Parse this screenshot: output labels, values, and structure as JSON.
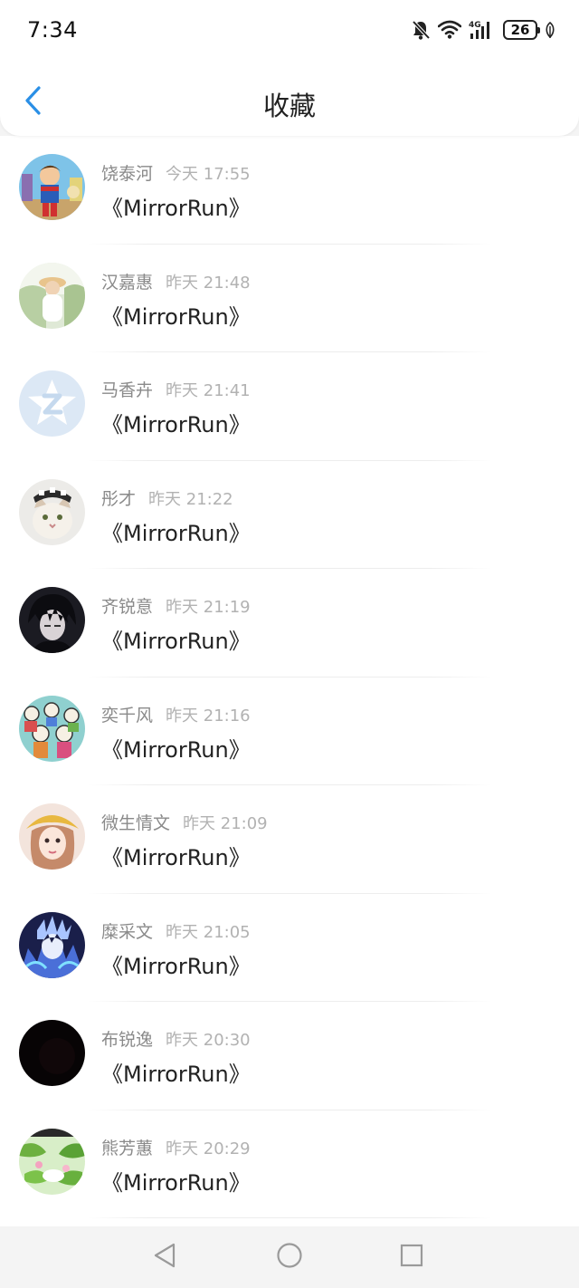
{
  "status_bar": {
    "time": "7:34",
    "network": "4G",
    "battery": "26"
  },
  "header": {
    "title": "收藏",
    "back_icon": "chevron-left-icon",
    "accent_color": "#2a8fe6"
  },
  "list": {
    "items": [
      {
        "name": "饶泰河",
        "time": "今天 17:55",
        "content": "《MirrorRun》",
        "avatar": "cartoon-superhero"
      },
      {
        "name": "汉嘉惠",
        "time": "昨天 21:48",
        "content": "《MirrorRun》",
        "avatar": "girl-in-hat"
      },
      {
        "name": "马香卉",
        "time": "昨天 21:41",
        "content": "《MirrorRun》",
        "avatar": "default-qq"
      },
      {
        "name": "彤才",
        "time": "昨天 21:22",
        "content": "《MirrorRun》",
        "avatar": "cat-with-bow"
      },
      {
        "name": "齐锐意",
        "time": "昨天 21:19",
        "content": "《MirrorRun》",
        "avatar": "anime-dark-boy"
      },
      {
        "name": "奕千风",
        "time": "昨天 21:16",
        "content": "《MirrorRun》",
        "avatar": "cartoon-group"
      },
      {
        "name": "微生情文",
        "time": "昨天 21:09",
        "content": "《MirrorRun》",
        "avatar": "girl-yellow-hat"
      },
      {
        "name": "糜采文",
        "time": "昨天 21:05",
        "content": "《MirrorRun》",
        "avatar": "anime-blue-fire"
      },
      {
        "name": "布锐逸",
        "time": "昨天 20:30",
        "content": "《MirrorRun》",
        "avatar": "black-dark"
      },
      {
        "name": "熊芳蕙",
        "time": "昨天 20:29",
        "content": "《MirrorRun》",
        "avatar": "green-leaves"
      }
    ]
  },
  "nav_bar": {
    "back": "triangle-back-icon",
    "home": "circle-home-icon",
    "recent": "square-recent-icon"
  }
}
